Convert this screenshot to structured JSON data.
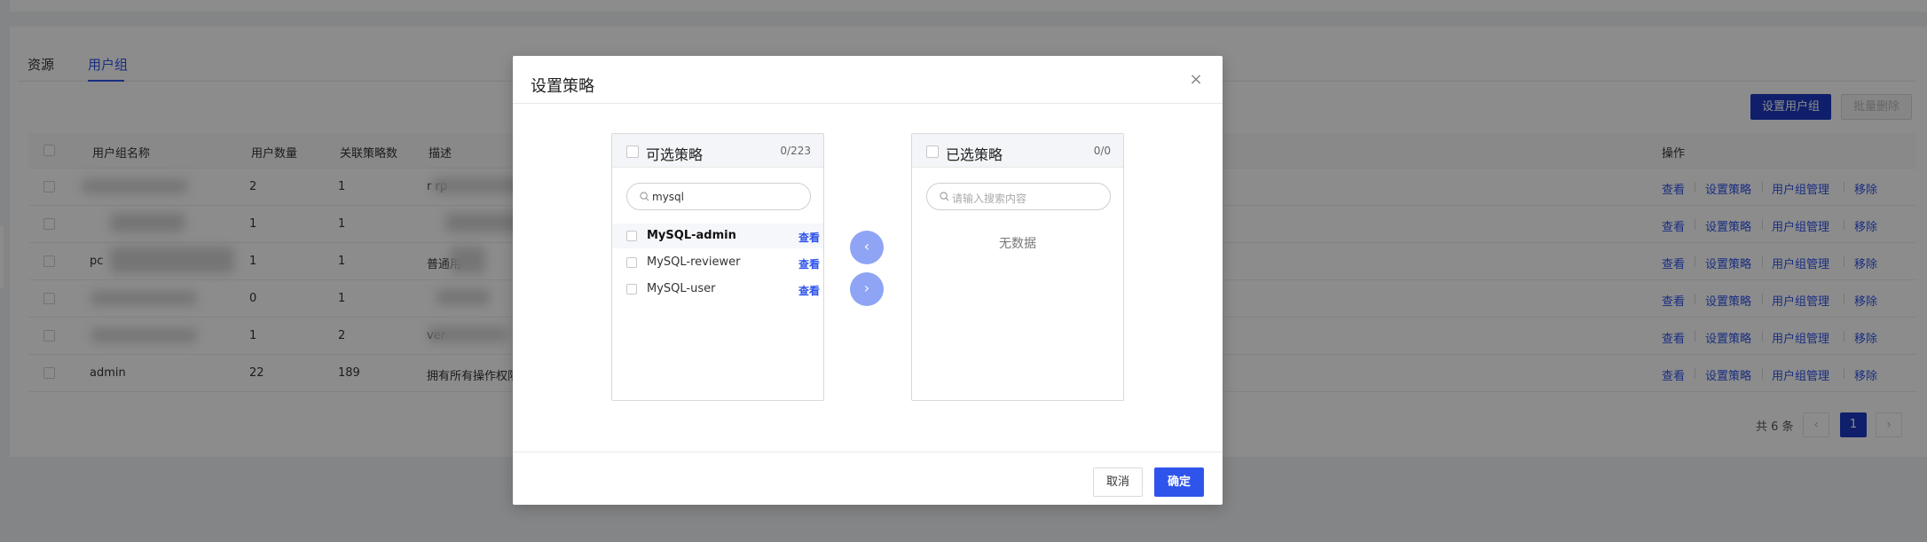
{
  "tabs": [
    {
      "label": "资源"
    },
    {
      "label": "用户组"
    }
  ],
  "toolbar": {
    "set_group_label": "设置用户组",
    "batch_delete_label": "批量删除"
  },
  "table": {
    "headers": {
      "name": "用户组名称",
      "count": "用户数量",
      "policy_count": "关联策略数",
      "desc": "描述",
      "ops": "操作"
    },
    "rows": [
      {
        "name": "",
        "count": "2",
        "policies": "1",
        "desc": "r                  rp"
      },
      {
        "name": "",
        "count": "1",
        "policies": "1",
        "desc": ""
      },
      {
        "name": "pc",
        "count": "1",
        "policies": "1",
        "desc": "普通用"
      },
      {
        "name": "",
        "count": "0",
        "policies": "1",
        "desc": ""
      },
      {
        "name": "",
        "count": "1",
        "policies": "2",
        "desc": "ver"
      },
      {
        "name": "admin",
        "count": "22",
        "policies": "189",
        "desc": "拥有所有操作权限"
      }
    ],
    "actions": {
      "view": "查看",
      "set_policy": "设置策略",
      "manage": "用户组管理",
      "remove": "移除"
    }
  },
  "pager": {
    "total": "共 6 条",
    "prev": "‹",
    "current": "1",
    "next": "›"
  },
  "modal": {
    "title": "设置策略",
    "close": "×",
    "left": {
      "title": "可选策略",
      "count": "0/223",
      "search_value": "mysql",
      "items": [
        {
          "label": "MySQL-admin",
          "view": "查看"
        },
        {
          "label": "MySQL-reviewer",
          "view": "查看"
        },
        {
          "label": "MySQL-user",
          "view": "查看"
        }
      ]
    },
    "right": {
      "title": "已选策略",
      "count": "0/0",
      "search_placeholder": "请输入搜索内容",
      "empty": "无数据"
    },
    "move_left": "‹",
    "move_right": "›",
    "cancel_label": "取消",
    "ok_label": "确定"
  }
}
